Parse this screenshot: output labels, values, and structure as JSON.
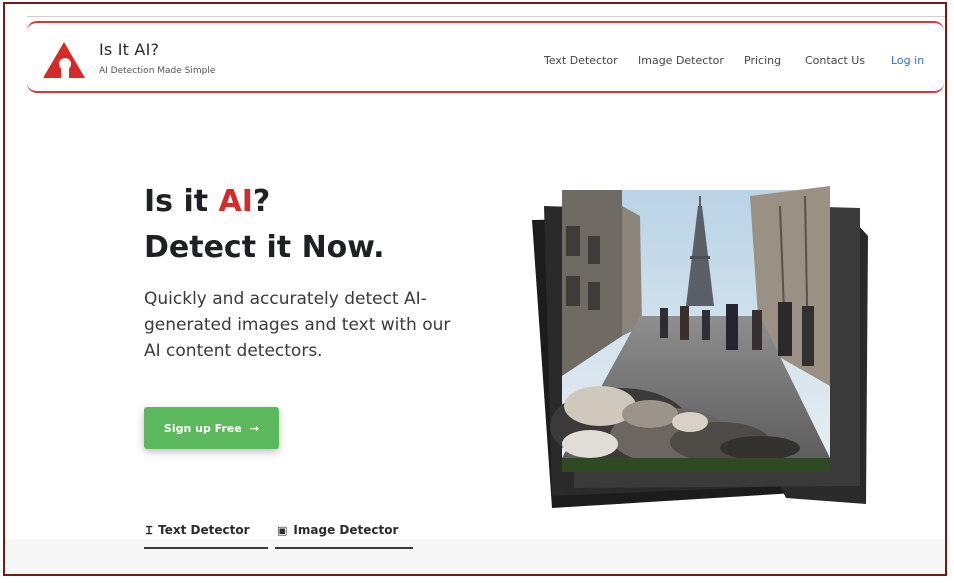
{
  "brand": {
    "title": "Is It AI?",
    "tagline": "AI Detection Made Simple",
    "accent_color": "#d43a3a"
  },
  "nav": {
    "items": [
      "Text Detector",
      "Image Detector",
      "Pricing",
      "Contact Us"
    ],
    "login": "Log in"
  },
  "hero": {
    "title_part1": "Is it ",
    "title_accent": "AI",
    "title_part2": "?",
    "title_line2": "Detect it Now.",
    "subtitle": "Quickly and accurately detect AI-generated images and text with our AI content detectors.",
    "cta_label": "Sign up Free",
    "cta_arrow": "→",
    "cta_color": "#5cb85c"
  },
  "tabs": [
    {
      "icon": "Ɪ",
      "label": "Text Detector"
    },
    {
      "icon": "▣",
      "label": "Image Detector"
    }
  ]
}
